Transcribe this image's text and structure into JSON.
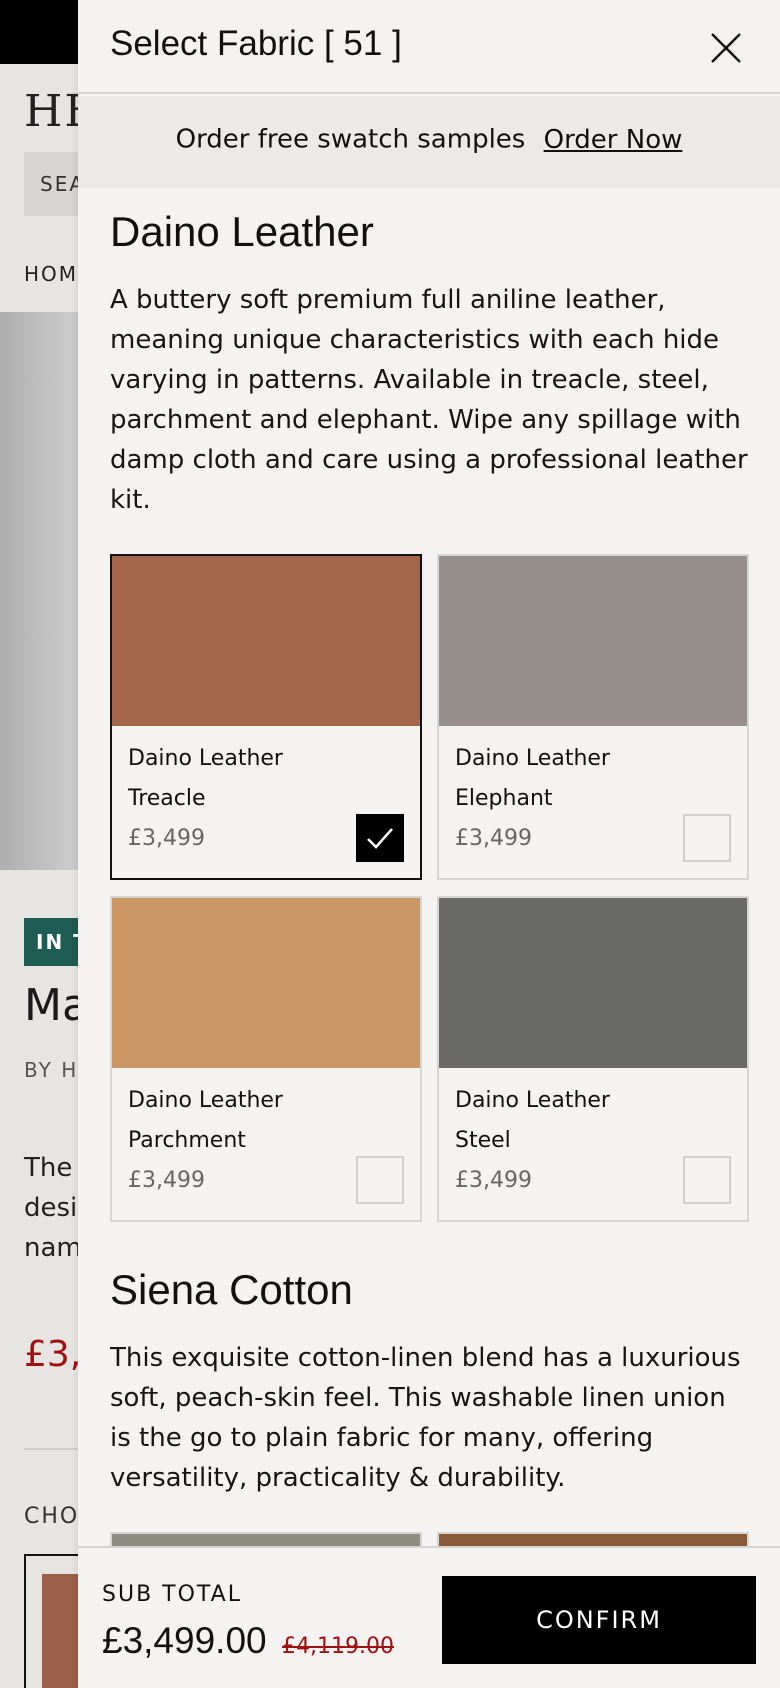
{
  "background_page": {
    "logo": "HE",
    "search_label": "SEA",
    "breadcrumb": "HOM",
    "badge": "IN T",
    "product_name": "Ma",
    "by_line": "BY H",
    "desc_lines": [
      "The",
      "desi",
      "nam"
    ],
    "price": "£3,",
    "choose_label": "CHO"
  },
  "drawer": {
    "title": "Select Fabric [ 51 ]",
    "close_icon": "close-icon",
    "promo": {
      "text": "Order free swatch samples",
      "link": "Order Now"
    },
    "sections": [
      {
        "title": "Daino Leather",
        "description": "A buttery soft premium full aniline leather, meaning unique characteristics with each hide varying in patterns. Available in treacle, steel, parchment and elephant. Wipe any spillage with damp cloth and care using a professional leather kit.",
        "fabrics": [
          {
            "line1": "Daino Leather",
            "line2": "Treacle",
            "price": "£3,499",
            "color": "#a5654a",
            "selected": true
          },
          {
            "line1": "Daino Leather",
            "line2": "Elephant",
            "price": "£3,499",
            "color": "#958e8a",
            "selected": false
          },
          {
            "line1": "Daino Leather",
            "line2": "Parchment",
            "price": "£3,499",
            "color": "#ca9764",
            "selected": false
          },
          {
            "line1": "Daino Leather",
            "line2": "Steel",
            "price": "£3,499",
            "color": "#6a6a69",
            "selected": false
          }
        ]
      },
      {
        "title": "Siena Cotton",
        "description": "This exquisite cotton-linen blend has a luxurious soft, peach-skin feel. This washable linen union is the go to plain fabric for many, offering versatility, practicality & durability.",
        "peek_colors": [
          "#8d8f7e",
          "#8a5a3a"
        ]
      }
    ],
    "footer": {
      "subtotal_label": "SUB TOTAL",
      "subtotal": "£3,499.00",
      "old_price": "£4,119.00",
      "confirm": "CONFIRM"
    }
  }
}
